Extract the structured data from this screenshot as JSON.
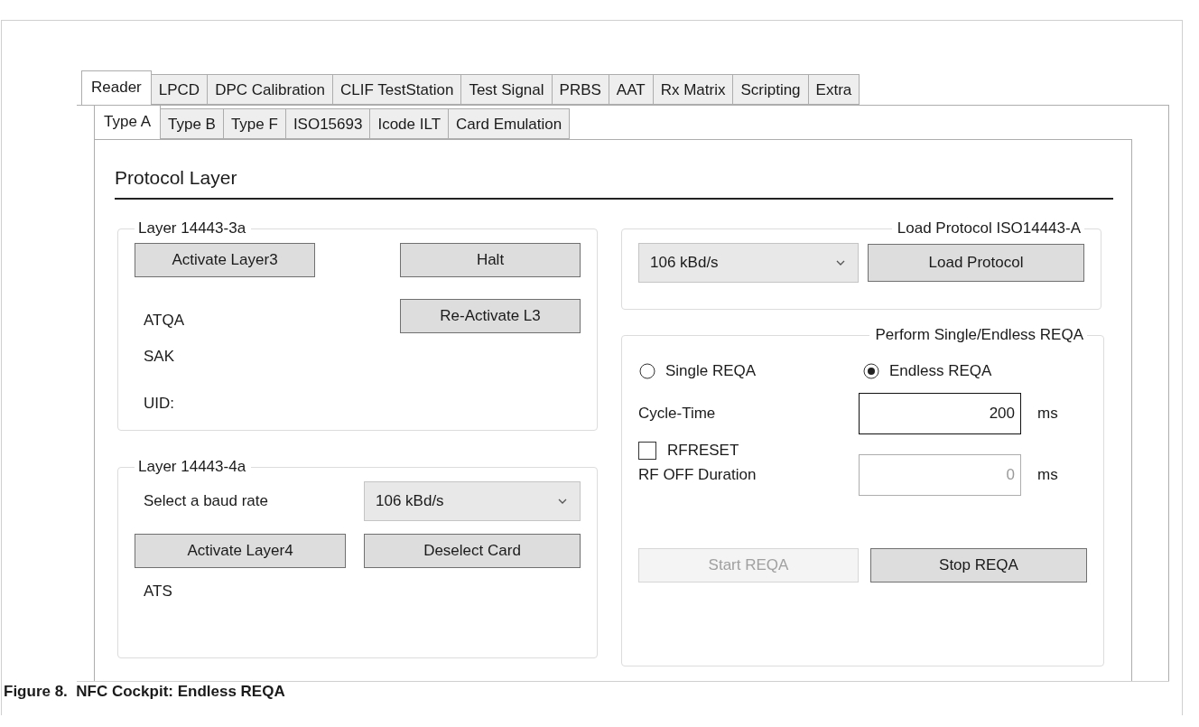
{
  "tabs": [
    {
      "label": "Reader",
      "selected": true
    },
    {
      "label": "LPCD",
      "selected": false
    },
    {
      "label": "DPC Calibration",
      "selected": false
    },
    {
      "label": "CLIF TestStation",
      "selected": false
    },
    {
      "label": "Test Signal",
      "selected": false
    },
    {
      "label": "PRBS",
      "selected": false
    },
    {
      "label": "AAT",
      "selected": false
    },
    {
      "label": "Rx Matrix",
      "selected": false
    },
    {
      "label": "Scripting",
      "selected": false
    },
    {
      "label": "Extra",
      "selected": false
    }
  ],
  "subtabs": [
    {
      "label": "Type A",
      "selected": true
    },
    {
      "label": "Type B",
      "selected": false
    },
    {
      "label": "Type F",
      "selected": false
    },
    {
      "label": "ISO15693",
      "selected": false
    },
    {
      "label": "Icode ILT",
      "selected": false
    },
    {
      "label": "Card Emulation",
      "selected": false
    }
  ],
  "section_title": "Protocol Layer",
  "layer3": {
    "title": "Layer 14443-3a",
    "activate_button": "Activate Layer3",
    "halt_button": "Halt",
    "reactivate_button": "Re-Activate L3",
    "labels": [
      "ATQA",
      "SAK",
      "UID:"
    ]
  },
  "layer4": {
    "title": "Layer 14443-4a",
    "baud_label": "Select a baud rate",
    "baud_value": "106 kBd/s",
    "activate_button": "Activate Layer4",
    "deselect_button": "Deselect Card",
    "ats_label": "ATS"
  },
  "load_protocol": {
    "title": "Load Protocol ISO14443-A",
    "rate_value": "106 kBd/s",
    "button": "Load Protocol"
  },
  "reqa": {
    "title": "Perform Single/Endless REQA",
    "modes": [
      {
        "label": "Single REQA",
        "selected": false
      },
      {
        "label": "Endless REQA",
        "selected": true
      }
    ],
    "cycle": {
      "label": "Cycle-Time",
      "value": "200",
      "unit": "ms",
      "disabled": false
    },
    "rfreset": {
      "label": "RFRESET",
      "checked": false
    },
    "rf_off": {
      "label": "RF OFF Duration",
      "value": "0",
      "unit": "ms",
      "disabled": true
    },
    "buttons": [
      {
        "label": "Start REQA",
        "disabled": true
      },
      {
        "label": "Stop REQA",
        "disabled": false
      }
    ]
  },
  "caption": "Figure 8.  NFC Cockpit: Endless REQA"
}
